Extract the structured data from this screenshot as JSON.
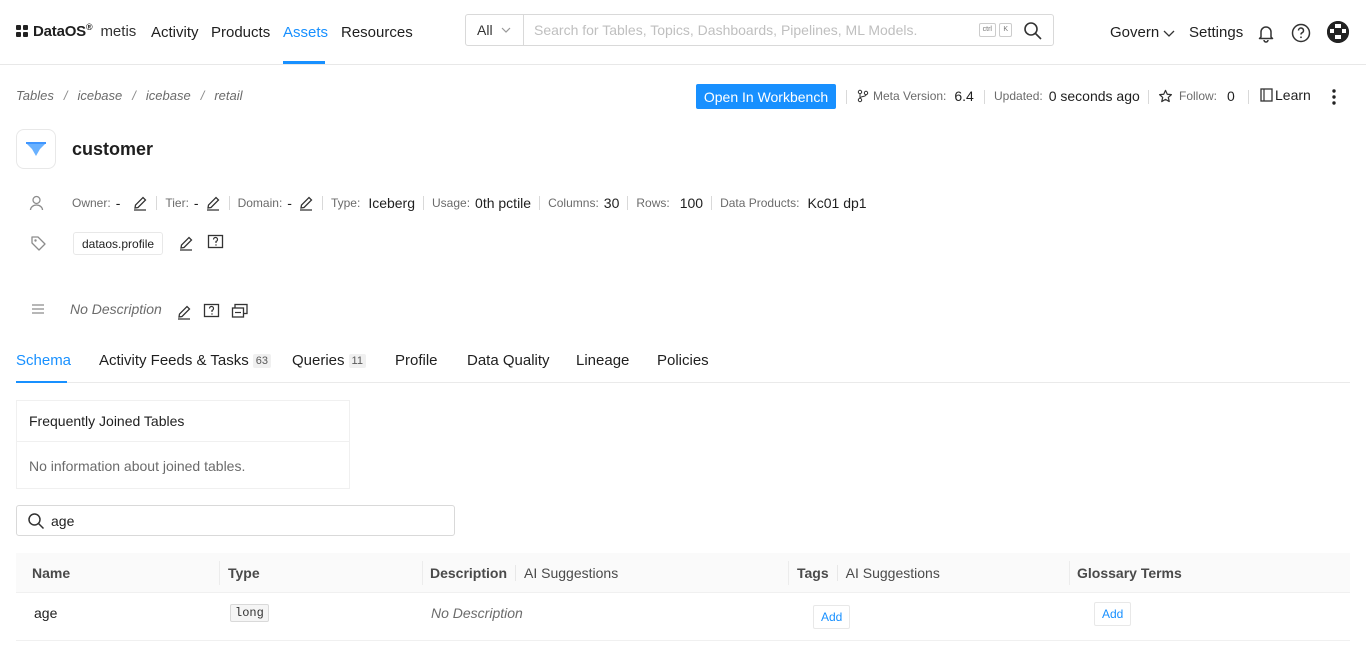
{
  "brand": {
    "name": "DataOS",
    "reg": "®",
    "product": "metis"
  },
  "nav": {
    "items": [
      "Activity",
      "Products",
      "Assets",
      "Resources"
    ],
    "active": "Assets"
  },
  "search": {
    "scope": "All",
    "placeholder": "Search for Tables, Topics, Dashboards, Pipelines, ML Models.",
    "shortcut_ctrl": "ctrl",
    "shortcut_key": "K"
  },
  "rightnav": {
    "govern": "Govern",
    "settings": "Settings"
  },
  "breadcrumb": [
    "Tables",
    "icebase",
    "icebase",
    "retail"
  ],
  "breadcrumb_sep": "/",
  "actions": {
    "workbench": "Open In Workbench",
    "meta_version_label": "Meta Version:",
    "meta_version": "6.4",
    "updated_label": "Updated:",
    "updated": "0 seconds ago",
    "follow_label": "Follow:",
    "follow_count": "0",
    "learn": "Learn"
  },
  "entity": {
    "name": "customer",
    "owner_label": "Owner:",
    "owner": "-",
    "tier_label": "Tier:",
    "tier": "-",
    "domain_label": "Domain:",
    "domain": "-",
    "type_label": "Type:",
    "type": "Iceberg",
    "usage_label": "Usage:",
    "usage": "0th pctile",
    "columns_label": "Columns:",
    "columns": "30",
    "rows_label": "Rows:",
    "rows": "100",
    "products_label": "Data Products:",
    "products": "Kc01 dp1",
    "tag": "dataos.profile",
    "description": "No Description"
  },
  "tabs": [
    {
      "label": "Schema",
      "count": ""
    },
    {
      "label": "Activity Feeds & Tasks",
      "count": "63"
    },
    {
      "label": "Queries",
      "count": "11"
    },
    {
      "label": "Profile",
      "count": ""
    },
    {
      "label": "Data Quality",
      "count": ""
    },
    {
      "label": "Lineage",
      "count": ""
    },
    {
      "label": "Policies",
      "count": ""
    }
  ],
  "joined": {
    "title": "Frequently Joined Tables",
    "empty": "No information about joined tables."
  },
  "filter": {
    "value": "age"
  },
  "table": {
    "headers": {
      "name": "Name",
      "type": "Type",
      "description": "Description",
      "description_ai": "AI Suggestions",
      "tags": "Tags",
      "tags_ai": "AI Suggestions",
      "glossary": "Glossary Terms"
    },
    "rows": [
      {
        "name": "age",
        "type": "long",
        "description": "No Description",
        "tags_action": "Add",
        "glossary_action": "Add"
      }
    ]
  },
  "colors": {
    "accent": "#1890ff",
    "text": "#1f1f1f",
    "muted": "#6b6b6b"
  }
}
